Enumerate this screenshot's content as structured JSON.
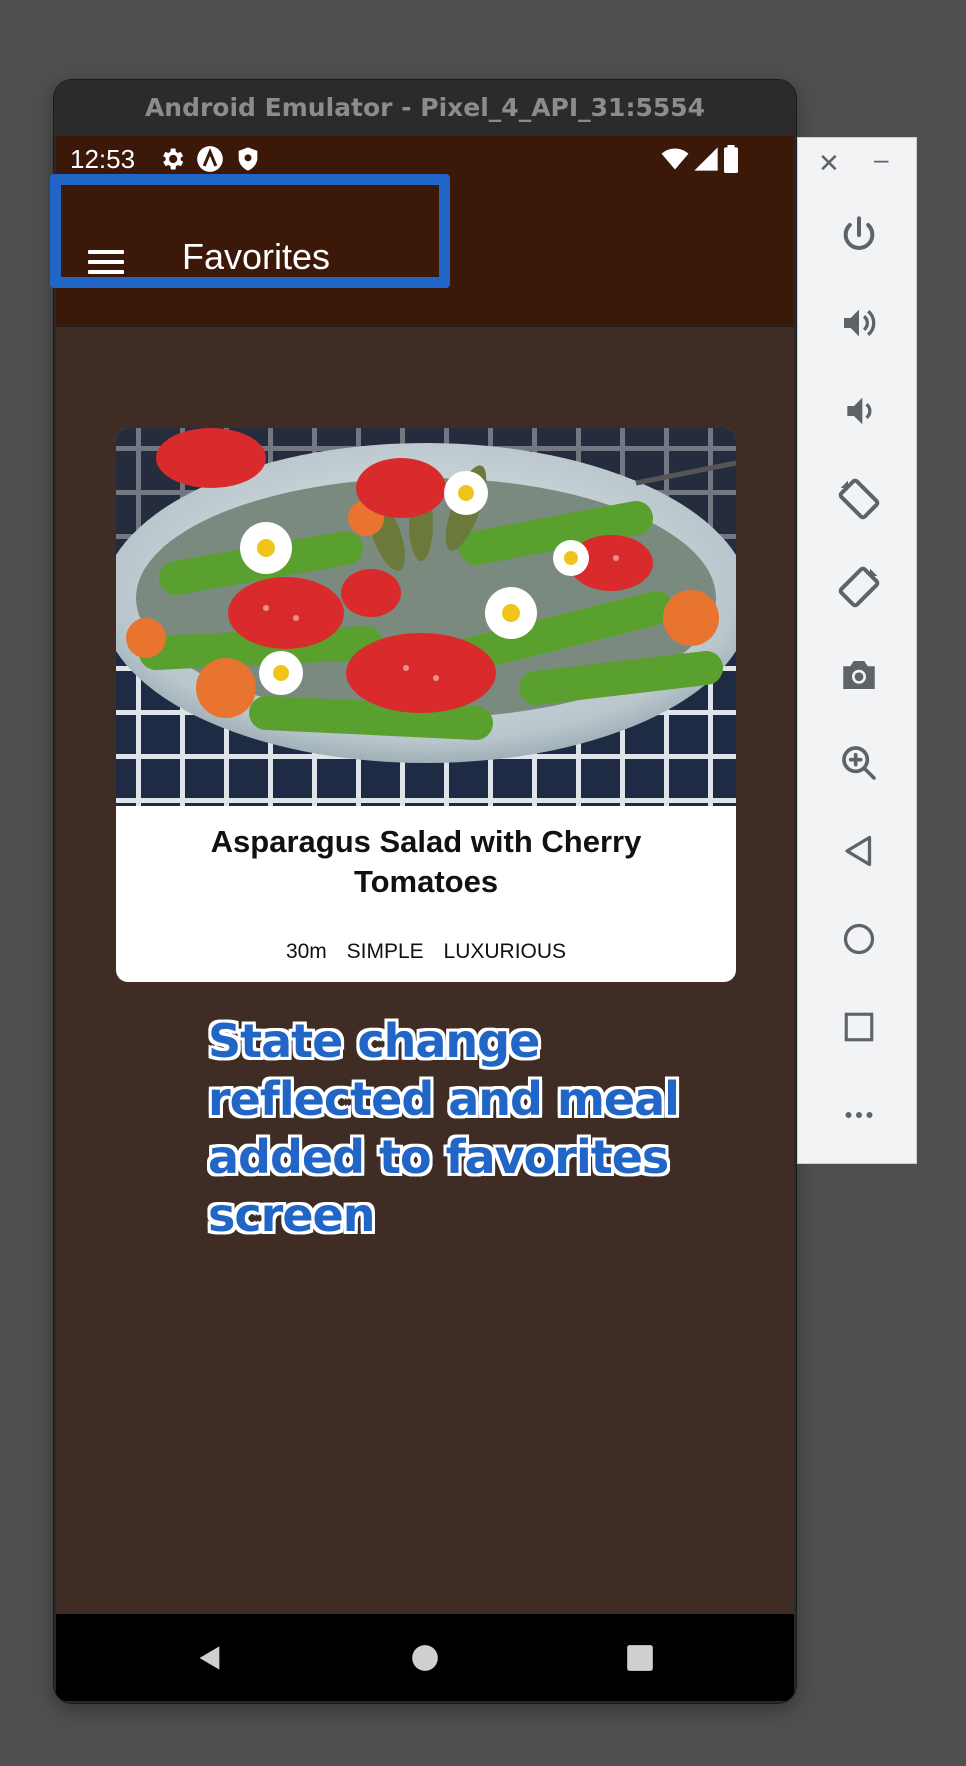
{
  "emulator": {
    "window_title": "Android Emulator - Pixel_4_API_31:5554"
  },
  "status_bar": {
    "time": "12:53",
    "icons": [
      "settings-icon",
      "a-badge-icon",
      "shield-icon",
      "wifi-icon",
      "signal-icon",
      "battery-icon"
    ]
  },
  "app_bar": {
    "title": "Favorites",
    "menu_icon": "hamburger-menu-icon"
  },
  "meal_card": {
    "image": "asparagus-salad-photo",
    "title": "Asparagus Salad with Cherry Tomatoes",
    "duration": "30m",
    "complexity": "SIMPLE",
    "affordability": "LUXURIOUS"
  },
  "annotation": {
    "text": "State change reflected and meal added to favorites screen"
  },
  "nav_bar": {
    "buttons": [
      "back-icon",
      "home-icon",
      "recents-icon"
    ]
  },
  "side_toolbar": {
    "buttons": [
      "close-icon",
      "minimize-icon",
      "power-icon",
      "volume-up-icon",
      "volume-down-icon",
      "rotate-left-icon",
      "rotate-right-icon",
      "camera-icon",
      "zoom-icon",
      "back-icon",
      "home-icon",
      "overview-icon",
      "more-icon"
    ]
  },
  "colors": {
    "app_bar": "#3b1808",
    "screen_bg": "#3e2c25",
    "highlight": "#2166c6",
    "annotation": "#2166c6"
  }
}
